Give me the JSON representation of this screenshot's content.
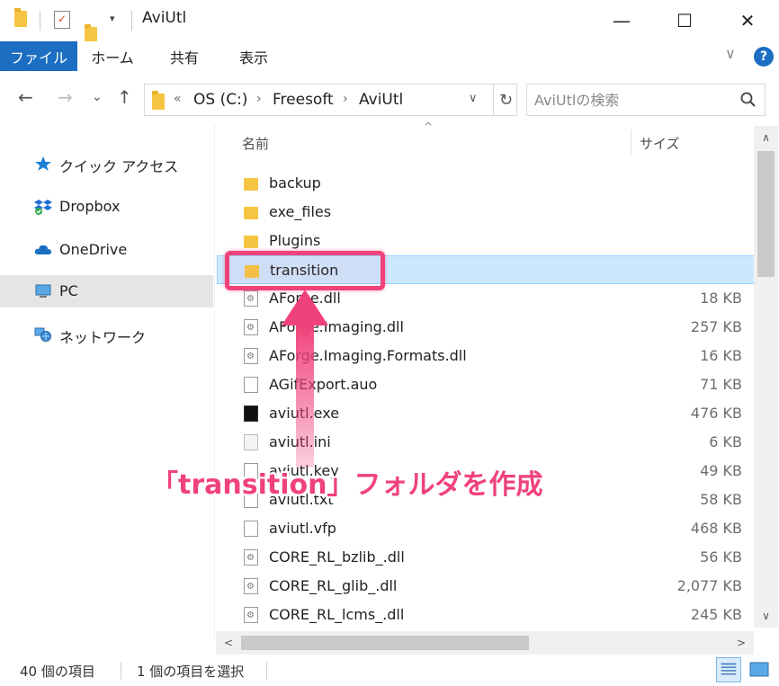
{
  "window": {
    "title": "AviUtl",
    "minimize_glyph": "—",
    "maximize_glyph": "☐",
    "close_glyph": "✕"
  },
  "ribbon": {
    "tabs": [
      "ファイル",
      "ホーム",
      "共有",
      "表示"
    ],
    "help": "?",
    "collapse": "∨"
  },
  "nav": {
    "back": "←",
    "forward": "→",
    "recent": "⌄",
    "up": "↑"
  },
  "address": {
    "overflow": "«",
    "crumbs": [
      "OS (C:)",
      "Freesoft",
      "AviUtl"
    ],
    "sep": "›",
    "dropdown": "∨",
    "refresh": "↻"
  },
  "search": {
    "placeholder": "AviUtlの検索"
  },
  "navpane": {
    "items": [
      {
        "label": "クイック アクセス",
        "icon": "star-icon"
      },
      {
        "label": "Dropbox",
        "icon": "dropbox-icon"
      },
      {
        "label": "OneDrive",
        "icon": "cloud-icon"
      },
      {
        "label": "PC",
        "icon": "computer-icon"
      },
      {
        "label": "ネットワーク",
        "icon": "network-icon"
      }
    ],
    "selected_index": 3
  },
  "columns": {
    "name": "名前",
    "size": "サイズ",
    "sort_caret": "^"
  },
  "files": [
    {
      "name": "backup",
      "size": "",
      "type": "folder"
    },
    {
      "name": "exe_files",
      "size": "",
      "type": "folder"
    },
    {
      "name": "Plugins",
      "size": "",
      "type": "folder"
    },
    {
      "name": "transition",
      "size": "",
      "type": "folder",
      "selected": true
    },
    {
      "name": "AForge.dll",
      "size": "18 KB",
      "type": "dll"
    },
    {
      "name": "AForge.Imaging.dll",
      "size": "257 KB",
      "type": "dll"
    },
    {
      "name": "AForge.Imaging.Formats.dll",
      "size": "16 KB",
      "type": "dll"
    },
    {
      "name": "AGifExport.auo",
      "size": "71 KB",
      "type": "file"
    },
    {
      "name": "aviutl.exe",
      "size": "476 KB",
      "type": "exe"
    },
    {
      "name": "aviutl.ini",
      "size": "6 KB",
      "type": "ini"
    },
    {
      "name": "aviutl.key",
      "size": "49 KB",
      "type": "file"
    },
    {
      "name": "aviutl.txt",
      "size": "58 KB",
      "type": "file"
    },
    {
      "name": "aviutl.vfp",
      "size": "468 KB",
      "type": "file"
    },
    {
      "name": "CORE_RL_bzlib_.dll",
      "size": "56 KB",
      "type": "dll"
    },
    {
      "name": "CORE_RL_glib_.dll",
      "size": "2,077 KB",
      "type": "dll"
    },
    {
      "name": "CORE_RL_lcms_.dll",
      "size": "245 KB",
      "type": "dll"
    }
  ],
  "scroll": {
    "up": "∧",
    "down": "∨",
    "left": "<",
    "right": ">"
  },
  "status": {
    "count": "40 個の項目",
    "selected": "1 個の項目を選択"
  },
  "annotation": {
    "text": "「transition」フォルダを作成",
    "color": "#f0427a"
  }
}
